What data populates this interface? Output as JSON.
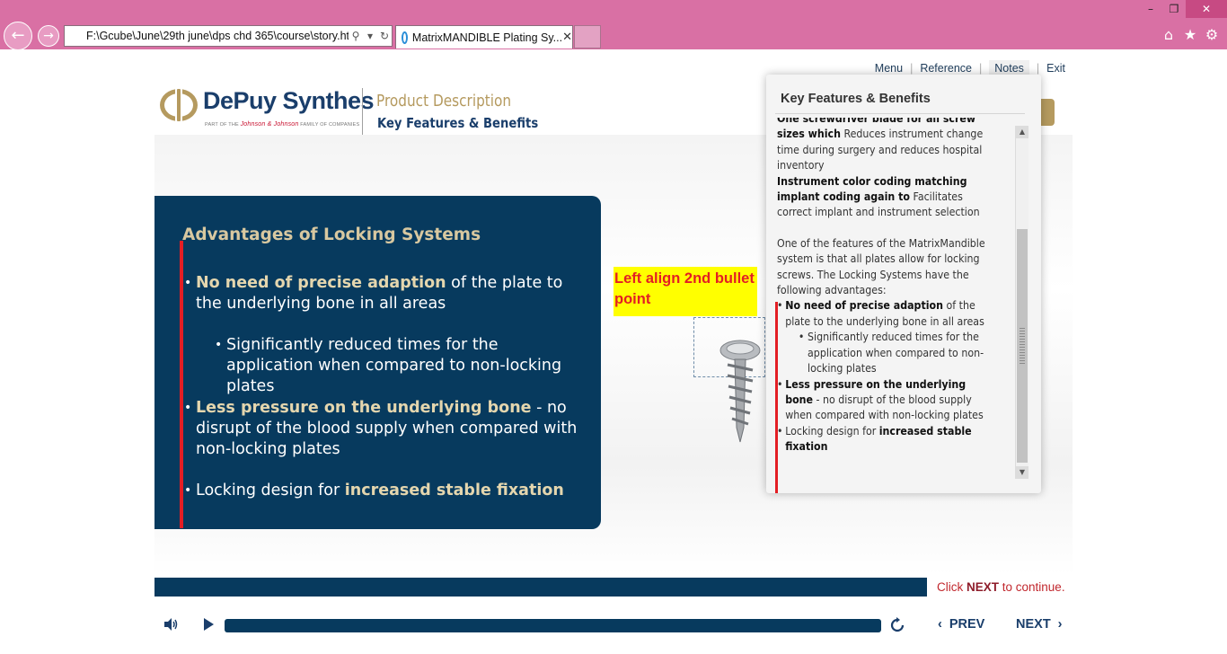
{
  "browser": {
    "address": "F:\\Gcube\\June\\29th june\\dps chd 365\\course\\story.ht",
    "tab_title": "MatrixMANDIBLE Plating Sy...",
    "window_buttons": [
      "–",
      "❐",
      "✕"
    ]
  },
  "topnav": [
    "Menu",
    "Reference",
    "Notes",
    "Exit"
  ],
  "header": {
    "brand": "DePuy Synthes",
    "brand_sub_pre": "PART OF THE",
    "brand_sub_jj": "Johnson & Johnson",
    "brand_sub_post": "FAMILY OF COMPANIES",
    "title": "Product Description",
    "subtitle": "Key Features & Benefits"
  },
  "content": {
    "title": "Advantages of Locking Systems",
    "bullet1_bold": "No need of precise adaption",
    "bullet1_rest": " of the plate to the underlying bone in all areas",
    "sub1": "Significantly reduced times for the application when compared to non-locking plates",
    "bullet2_bold": "Less pressure on the underlying bone",
    "bullet2_rest": " - no disrupt of the blood supply when compared with non-locking plates",
    "bullet3_pre": "Locking design for ",
    "bullet3_bold": "increased stable fixation"
  },
  "annotation": "Left align 2nd bullet point",
  "notes": {
    "title": "Key Features & Benefits",
    "p1_bold": "One screwdriver blade for all screw sizes which",
    "p1_rest": " Reduces instrument change time during surgery and reduces hospital inventory",
    "p2_bold": "Instrument color coding matching implant coding again to",
    "p2_rest": " Facilitates correct implant and instrument selection",
    "p3": "One of the features of the MatrixMandible system is that all plates allow for locking screws.  The Locking Systems have the following advantages:",
    "b1_bold": "No need of precise adaption",
    "b1_rest": " of the plate to the underlying bone in all areas",
    "b1_sub": "Significantly reduced times for the application when compared to non-locking plates",
    "b2_bold": "Less pressure on the underlying bone",
    "b2_rest": " - no disrupt of the blood supply when compared with non-locking plates",
    "b3_pre": "Locking design for ",
    "b3_bold": "increased stable fixation"
  },
  "footer": {
    "click_pre": "Click ",
    "click_next": "NEXT",
    "click_post": " to continue.",
    "prev": "PREV",
    "next": "NEXT"
  },
  "colors": {
    "navy": "#073a5e",
    "gold": "#b59a5f",
    "red": "#e31e24",
    "chrome": "#d970a4"
  },
  "icons": [
    "back-arrow-icon",
    "forward-arrow-icon",
    "search-icon",
    "refresh-icon",
    "ie-icon",
    "close-icon",
    "home-icon",
    "star-icon",
    "gear-icon",
    "volume-icon",
    "play-icon",
    "replay-icon",
    "chevron-left-icon",
    "chevron-right-icon"
  ]
}
